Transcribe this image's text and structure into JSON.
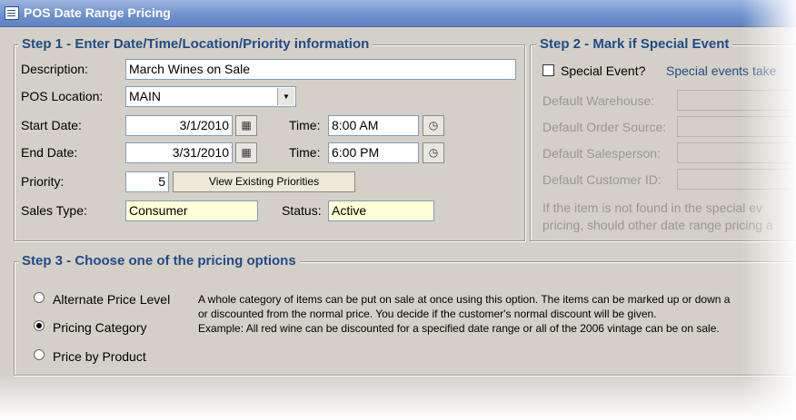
{
  "window": {
    "title": "POS Date Range Pricing"
  },
  "step1": {
    "header": "Step 1 - Enter Date/Time/Location/Priority information",
    "description_label": "Description:",
    "description_value": "March Wines on Sale",
    "location_label": "POS Location:",
    "location_value": "MAIN",
    "start_date_label": "Start Date:",
    "start_date_value": "3/1/2010",
    "start_time_label": "Time:",
    "start_time_value": "8:00 AM",
    "end_date_label": "End Date:",
    "end_date_value": "3/31/2010",
    "end_time_label": "Time:",
    "end_time_value": "6:00 PM",
    "priority_label": "Priority:",
    "priority_value": "5",
    "view_priorities_button": "View Existing Priorities",
    "sales_type_label": "Sales Type:",
    "sales_type_value": "Consumer",
    "status_label": "Status:",
    "status_value": "Active"
  },
  "step2": {
    "header": "Step 2 - Mark if Special Event",
    "special_event_label": "Special Event?",
    "special_event_checked": false,
    "special_event_note": "Special events take",
    "default_warehouse_label": "Default Warehouse:",
    "default_order_source_label": "Default Order Source:",
    "default_salesperson_label": "Default Salesperson:",
    "default_customer_label": "Default Customer ID:",
    "fallback_note_line1": "If the item is not found in the special ev",
    "fallback_note_line2": "pricing, should other date range pricing a"
  },
  "step3": {
    "header": "Step 3 - Choose one of the pricing options",
    "options": [
      {
        "label": "Alternate Price Level",
        "selected": false
      },
      {
        "label": "Pricing Category",
        "selected": true
      },
      {
        "label": "Price by Product",
        "selected": false
      }
    ],
    "description_line1": "A whole category of items can be put on sale at once using this option.  The items can be marked up or down a",
    "description_line2": "or discounted from the normal price. You decide if the customer's normal discount will be given.",
    "description_line3": "Example: All red wine can be discounted for a specified date range or all of the 2006 vintage can be on sale."
  },
  "icons": {
    "calendar": "calendar-icon",
    "clock": "clock-icon",
    "dropdown": "chevron-down-icon"
  }
}
